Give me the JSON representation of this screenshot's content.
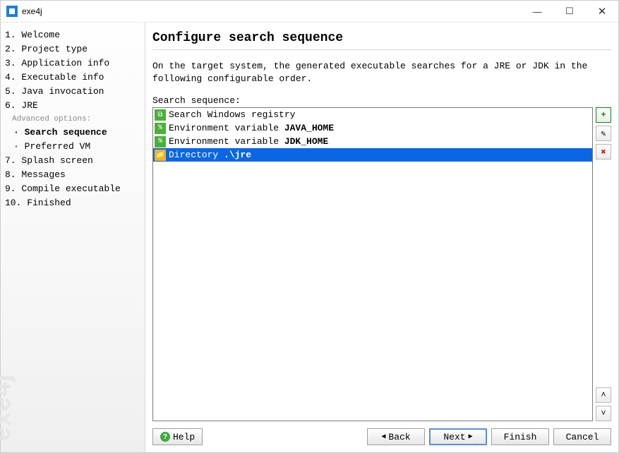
{
  "window": {
    "title": "exe4j"
  },
  "sidebar": {
    "steps": [
      "1. Welcome",
      "2. Project type",
      "3. Application info",
      "4. Executable info",
      "5. Java invocation",
      "6. JRE"
    ],
    "adv_label": "Advanced options:",
    "substeps": [
      "· Search sequence",
      "· Preferred VM"
    ],
    "steps2": [
      "7. Splash screen",
      "8. Messages",
      "9. Compile executable",
      "10. Finished"
    ],
    "watermark": "exe4j"
  },
  "main": {
    "heading": "Configure search sequence",
    "description": "On the target system, the generated executable searches for a JRE or JDK in the following configurable order.",
    "list_label": "Search sequence:",
    "items": [
      {
        "icon": "reg",
        "text_pre": "Search Windows registry",
        "bold": "",
        "sel": false
      },
      {
        "icon": "env",
        "text_pre": "Environment variable ",
        "bold": "JAVA_HOME",
        "sel": false
      },
      {
        "icon": "env",
        "text_pre": "Environment variable ",
        "bold": "JDK_HOME",
        "sel": false
      },
      {
        "icon": "dir",
        "text_pre": "Directory ",
        "bold": ".\\jre",
        "sel": true
      }
    ]
  },
  "buttons": {
    "help": "Help",
    "back": "Back",
    "next": "Next",
    "finish": "Finish",
    "cancel": "Cancel"
  },
  "tools": {
    "add": "+",
    "edit": "✎",
    "delete": "✖",
    "up": "˄",
    "down": "˅"
  },
  "icons": {
    "reg": "⧉",
    "env": "%",
    "dir": "📁"
  }
}
